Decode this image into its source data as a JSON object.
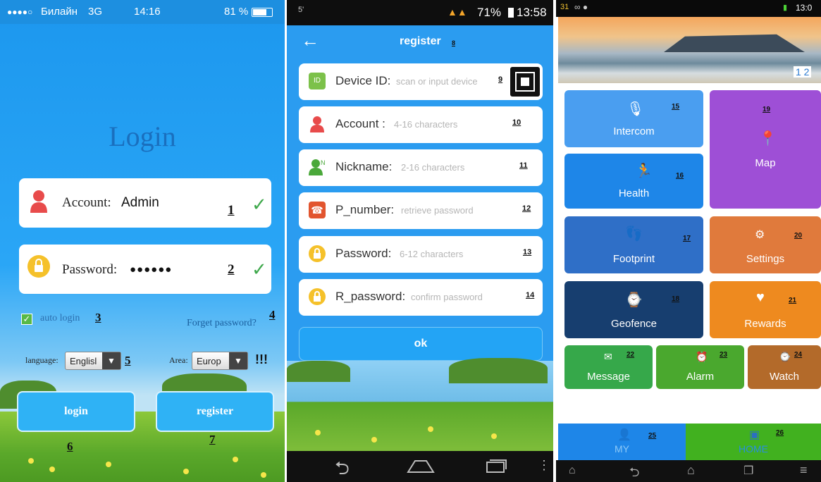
{
  "login_screen": {
    "status": {
      "signal": "●●●●○",
      "carrier": "Билайн",
      "network": "3G",
      "time": "14:16",
      "battery": "81 %"
    },
    "title": "Login",
    "account": {
      "label": "Account:",
      "value": "Admin",
      "num": "1"
    },
    "password": {
      "label": "Password:",
      "value": "●●●●●●",
      "num": "2"
    },
    "auto_login": {
      "label": "auto login",
      "num": "3"
    },
    "forget": {
      "label": "Forget password?",
      "num": "4"
    },
    "language": {
      "label": "language:",
      "value": "Englisl",
      "num": "5"
    },
    "area": {
      "label": "Area:",
      "value": "Europ",
      "mark": "!!!"
    },
    "login_btn": {
      "label": "login",
      "num": "6"
    },
    "register_btn": {
      "label": "register",
      "num": "7"
    }
  },
  "register_screen": {
    "status": {
      "left": "5'",
      "battery": "71%",
      "time": "13:58"
    },
    "title": "register",
    "title_num": "8",
    "fields": [
      {
        "label": "Device ID:",
        "placeholder": "scan or input device",
        "num": "9",
        "icon": "id-icon"
      },
      {
        "label": "Account :",
        "placeholder": "4-16 characters",
        "num": "10",
        "icon": "person-icon"
      },
      {
        "label": "Nickname:",
        "placeholder": "2-16 characters",
        "num": "11",
        "icon": "person-n-icon"
      },
      {
        "label": "P_number:",
        "placeholder": "retrieve password",
        "num": "12",
        "icon": "phone-icon"
      },
      {
        "label": "Password:",
        "placeholder": "6-12 characters",
        "num": "13",
        "icon": "lock-icon"
      },
      {
        "label": "R_password:",
        "placeholder": "confirm password",
        "num": "14",
        "icon": "lock-icon"
      }
    ],
    "id_badge": "ID",
    "ok": "ok"
  },
  "home_screen": {
    "status": {
      "left": "31",
      "time": "13:0"
    },
    "banner_pages": "1 2",
    "tiles": [
      {
        "label": "Intercom",
        "num": "15",
        "color": "#4a9ef0"
      },
      {
        "label": "Map",
        "num": "19",
        "color": "#9e4fd6"
      },
      {
        "label": "Health",
        "num": "16",
        "color": "#1e86e8"
      },
      {
        "label": "Footprint",
        "num": "17",
        "color": "#2f6fc7"
      },
      {
        "label": "Settings",
        "num": "20",
        "color": "#e07a3c"
      },
      {
        "label": "Geofence",
        "num": "18",
        "color": "#173e6f"
      },
      {
        "label": "Rewards",
        "num": "21",
        "color": "#ee8a1f"
      },
      {
        "label": "Message",
        "num": "22",
        "color": "#36a84a"
      },
      {
        "label": "Alarm",
        "num": "23",
        "color": "#4aa82e"
      },
      {
        "label": "Watch",
        "num": "24",
        "color": "#b36a2a"
      }
    ],
    "tabs": [
      {
        "label": "MY",
        "num": "25"
      },
      {
        "label": "HOME",
        "num": "26"
      }
    ]
  }
}
